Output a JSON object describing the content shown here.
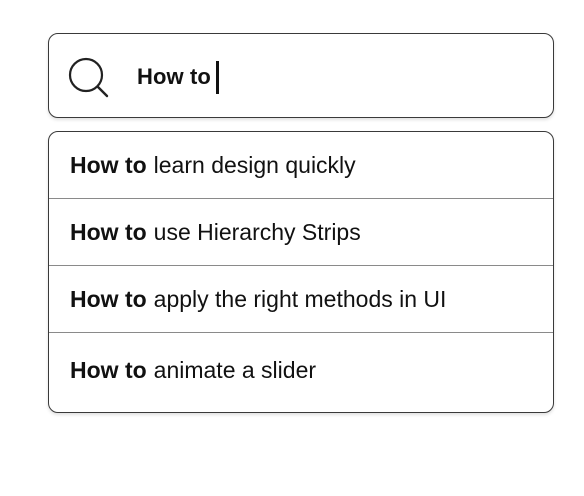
{
  "search": {
    "query": "How to",
    "icon": "search-icon"
  },
  "suggestions": [
    {
      "prefix": "How to",
      "rest": "learn design quickly"
    },
    {
      "prefix": "How to",
      "rest": "use Hierarchy Strips"
    },
    {
      "prefix": "How to",
      "rest": "apply the right methods in UI"
    },
    {
      "prefix": "How to",
      "rest": "animate a slider"
    }
  ]
}
